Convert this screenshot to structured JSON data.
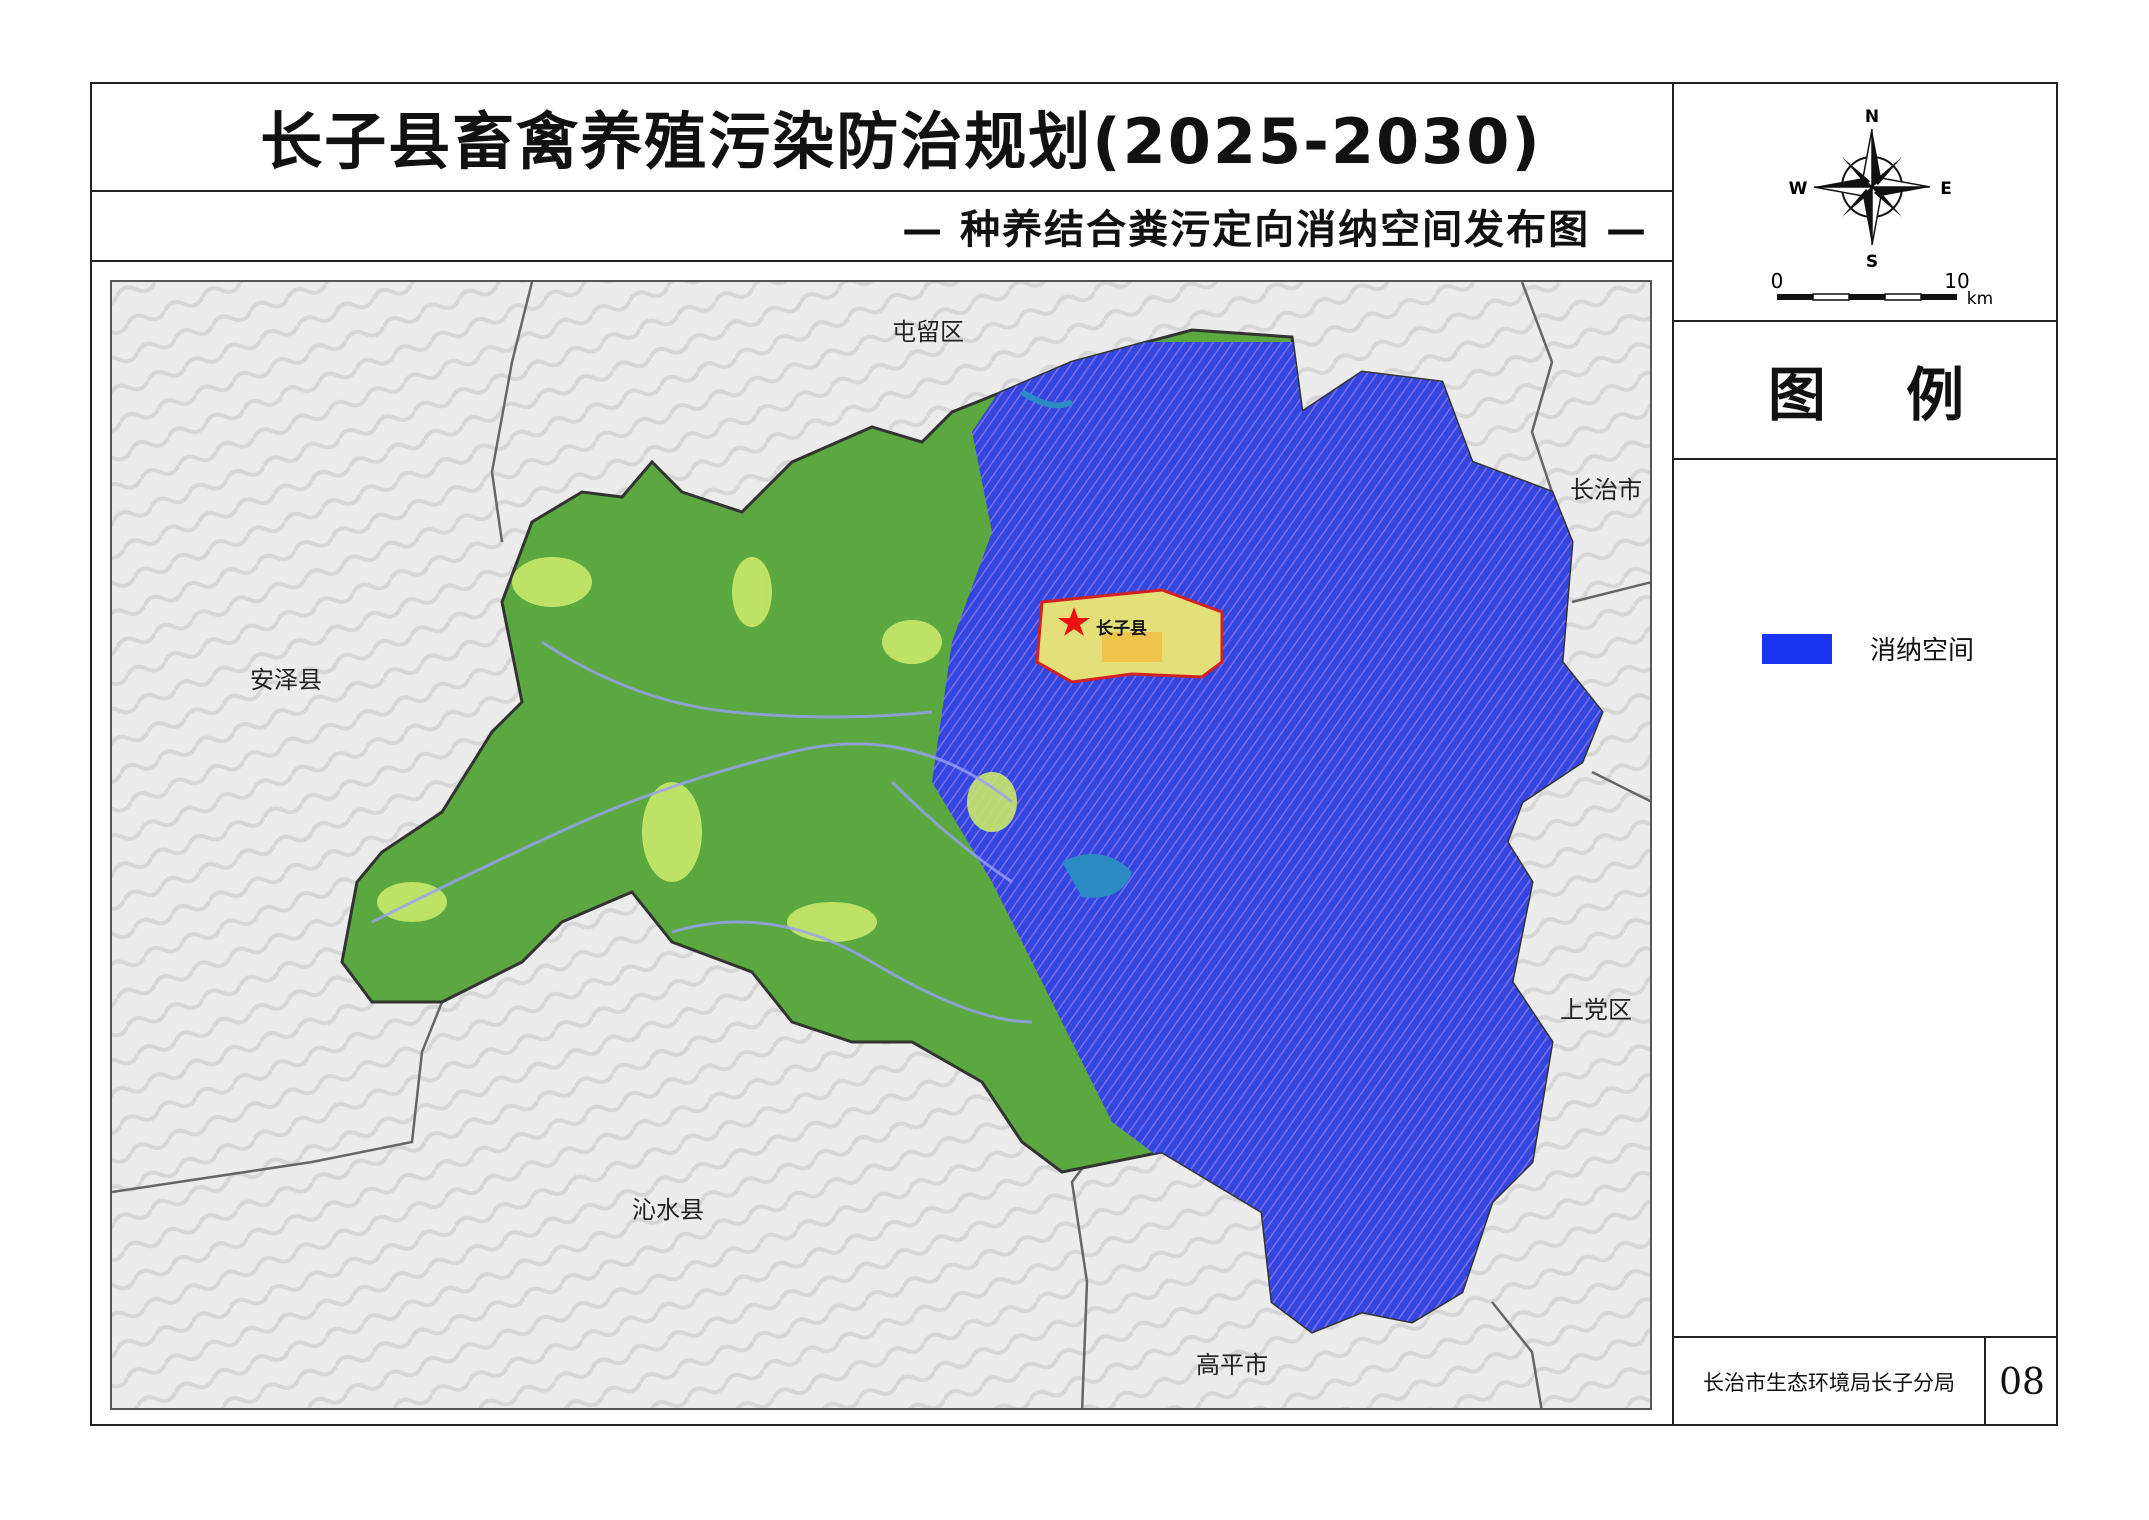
{
  "title": "长子县畜禽养殖污染防治规划(2025-2030)",
  "subtitle": "— 种养结合粪污定向消纳空间发布图 —",
  "compass": {
    "n": "N",
    "s": "S",
    "e": "E",
    "w": "W"
  },
  "scale_bar": {
    "zero": "0",
    "ten": "10",
    "unit": "km"
  },
  "legend": {
    "title": "图 例",
    "items": [
      {
        "label": "消纳空间",
        "color": "#1a35f0"
      }
    ]
  },
  "map": {
    "neighbors": [
      "屯留区",
      "长治市",
      "安泽县",
      "上党区",
      "沁水县",
      "高平市"
    ],
    "county_seat": "长子县"
  },
  "footer": {
    "org": "长治市生态环境局长子分局",
    "number": "08"
  },
  "colors": {
    "forest": "#5aa83f",
    "grass": "#c9e86a",
    "sink": "#1a35f0",
    "hillshade": "#e9e9e9"
  }
}
